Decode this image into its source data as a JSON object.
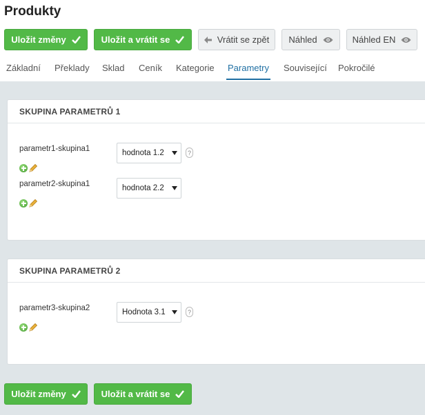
{
  "page": {
    "title": "Produkty"
  },
  "toolbar": {
    "save_label": "Uložit změny",
    "save_return_label": "Uložit a vrátit se",
    "back_label": "Vrátit se zpět",
    "preview_label": "Náhled",
    "preview_en_label": "Náhled EN"
  },
  "tabs": [
    {
      "label": "Základní"
    },
    {
      "label": "Překlady"
    },
    {
      "label": "Sklad"
    },
    {
      "label": "Ceník"
    },
    {
      "label": "Kategorie"
    },
    {
      "label": "Parametry",
      "active": true
    },
    {
      "label": "Související"
    },
    {
      "label": "Pokročilé"
    }
  ],
  "groups": [
    {
      "title": "SKUPINA PARAMETRŮ 1",
      "params": [
        {
          "label": "parametr1-skupina1",
          "value": "hodnota 1.2",
          "has_help": true
        },
        {
          "label": "parametr2-skupina1",
          "value": "hodnota 2.2",
          "has_help": false
        }
      ]
    },
    {
      "title": "SKUPINA PARAMETRŮ 2",
      "params": [
        {
          "label": "parametr3-skupina2",
          "value": "Hodnota 3.1",
          "has_help": true
        }
      ]
    }
  ],
  "help_label": "?",
  "colors": {
    "accent": "#1f6fa3",
    "green": "#52b947",
    "bg": "#dfe5e8"
  }
}
